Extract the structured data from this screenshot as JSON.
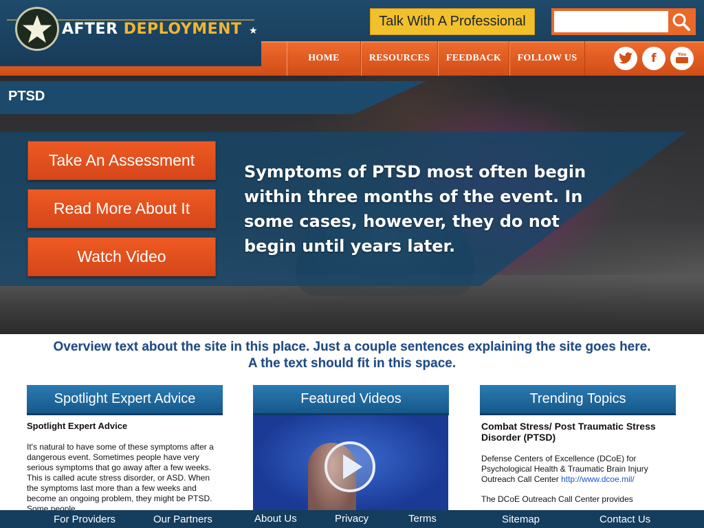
{
  "header": {
    "logo_word1": "AFTER",
    "logo_word2": "DEPLOYMENT",
    "talk_button": "Talk With A Professional",
    "search_placeholder": ""
  },
  "nav": {
    "items": [
      "HOME",
      "RESOURCES",
      "FEEDBACK",
      "FOLLOW US"
    ],
    "social": [
      "twitter-icon",
      "facebook-icon",
      "youtube-icon"
    ]
  },
  "hero": {
    "page_title": "PTSD",
    "buttons": [
      "Take An Assessment",
      "Read More About It",
      "Watch Video"
    ],
    "quote": "Symptoms of PTSD most often begin within three months of the event. In some cases, however, they do not begin until years later."
  },
  "overview": {
    "line1": "Overview text about the site in this place. Just a couple sentences explaining the site goes here.",
    "line2": "A the text should fit in this space."
  },
  "columns": {
    "spotlight": {
      "header": "Spotlight Expert Advice",
      "title": "Spotlight Expert Advice",
      "body": "It's natural to have some of these symptoms after a dangerous event. Sometimes people have very serious symptoms that go away after a few weeks. This is called acute stress disorder, or ASD. When the symptoms last more than a few weeks and become an ongoing problem, they might be PTSD. Some people"
    },
    "videos": {
      "header": "Featured Videos"
    },
    "trending": {
      "header": "Trending Topics",
      "title": "Combat Stress/ Post Traumatic Stress Disorder (PTSD)",
      "body1": "Defense Centers of Excellence (DCoE) for Psychological Health & Traumatic Brain Injury Outreach Call Center",
      "link": "http://www.dcoe.mil/",
      "body2": "The DCoE Outreach Call Center provides"
    }
  },
  "footer": {
    "links": [
      "For Providers",
      "Our Partners",
      "About Us",
      "Privacy",
      "Terms",
      "Sitemap",
      "Contact Us"
    ]
  }
}
